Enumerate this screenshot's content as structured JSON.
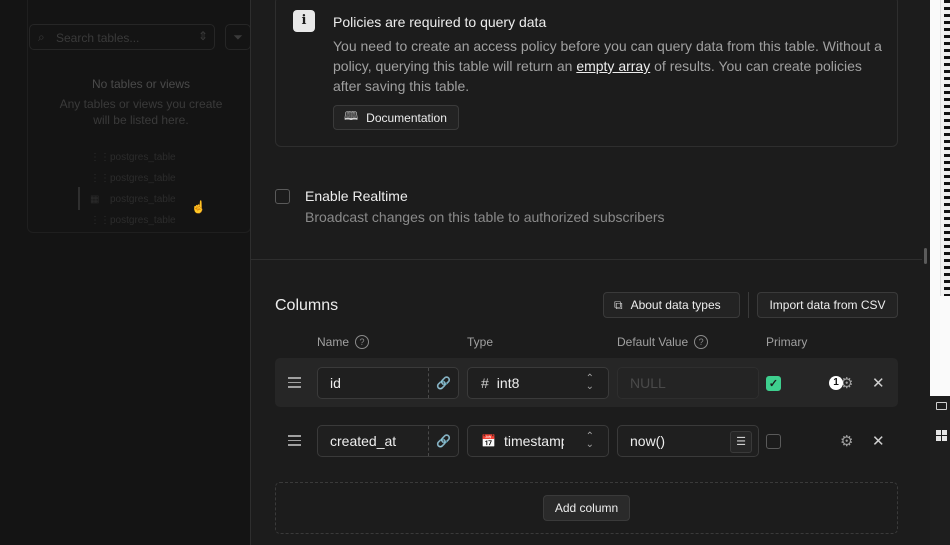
{
  "sidebar": {
    "search_placeholder": "Search tables...",
    "empty_title": "No tables or views",
    "empty_subtitle": "Any tables or views you create will be listed here.",
    "items": [
      "postgres_table",
      "postgres_table",
      "postgres_table",
      "postgres_table"
    ]
  },
  "notice": {
    "title": "Policies are required to query data",
    "body_before": "You need to create an access policy before you can query data from this table. Without a policy, querying this table will return an ",
    "body_link": "empty array",
    "body_after": " of results. You can create policies after saving this table.",
    "doc_button": "Documentation"
  },
  "realtime": {
    "label": "Enable Realtime",
    "description": "Broadcast changes on this table to authorized subscribers",
    "checked": false
  },
  "columns": {
    "title": "Columns",
    "about_button": "About data types",
    "import_button": "Import data from CSV",
    "headers": {
      "name": "Name",
      "type": "Type",
      "default": "Default Value",
      "primary": "Primary"
    },
    "rows": [
      {
        "name": "id",
        "type": "int8",
        "type_icon": "hash-icon",
        "default": "",
        "default_placeholder": "NULL",
        "primary": true,
        "badge": "1"
      },
      {
        "name": "created_at",
        "type": "timestamp",
        "type_icon": "calendar-icon",
        "default": "now()",
        "default_placeholder": "",
        "primary": false
      }
    ],
    "add_button": "Add column"
  },
  "colors": {
    "accent": "#3ecf8e",
    "background": "#1c1c1c"
  }
}
